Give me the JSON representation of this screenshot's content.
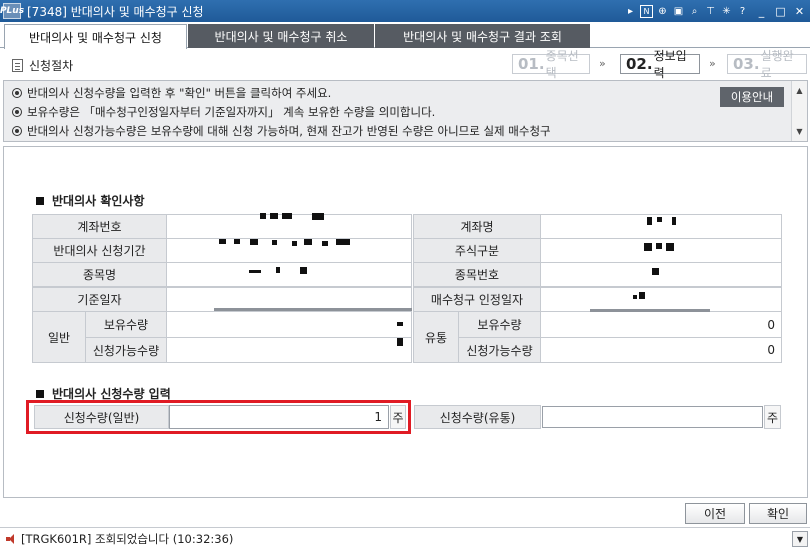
{
  "window": {
    "app_logo": "PLus",
    "title": "[7348] 반대의사 및 매수청구 신청",
    "title_icons": [
      "arrow-right-icon",
      "n-box-icon",
      "zoom-icon",
      "window-icon",
      "magnifier-icon",
      "pin-icon",
      "star-icon",
      "help-icon"
    ],
    "n_box_label": "N",
    "help_label": "?"
  },
  "tabs": [
    {
      "label": "반대의사 및 매수청구 신청",
      "active": true
    },
    {
      "label": "반대의사 및 매수청구 취소",
      "active": false
    },
    {
      "label": "반대의사 및 매수청구 결과 조회",
      "active": false
    }
  ],
  "steps": {
    "label": "신청절차",
    "items": [
      {
        "num": "01.",
        "label": "종목선택",
        "state": "done"
      },
      {
        "num": "02.",
        "label": "정보입력",
        "state": "current"
      },
      {
        "num": "03.",
        "label": "실행완료",
        "state": "pending"
      }
    ],
    "arrow": "»"
  },
  "info": {
    "lines": [
      "반대의사 신청수량을 입력한 후 \"확인\" 버튼을 클릭하여 주세요.",
      "보유수량은 「매수청구인정일자부터 기준일자까지」 계속 보유한 수량을 의미합니다.",
      "반대의사 신청가능수량은 보유수량에 대해 신청 가능하며, 현재 잔고가 반영된 수량은 아니므로 실제 매수청구"
    ],
    "guide_button": "이용안내"
  },
  "confirm_section": {
    "title": "반대의사 확인사항",
    "left_labels": [
      "계좌번호",
      "반대의사 신청기간",
      "종목명",
      "기준일자"
    ],
    "right_labels": [
      "계좌명",
      "주식구분",
      "종목번호",
      "매수청구 인정일자"
    ],
    "general": {
      "group": "일반",
      "holding_label": "보유수량",
      "available_label": "신청가능수량",
      "holding_value": "",
      "available_value": ""
    },
    "circulation": {
      "group": "유통",
      "holding_label": "보유수량",
      "available_label": "신청가능수량",
      "holding_value": "0",
      "available_value": "0"
    }
  },
  "input_section": {
    "title": "반대의사 신청수량 입력",
    "general_label": "신청수량(일반)",
    "general_value": "1",
    "general_unit": "주",
    "circulation_label": "신청수량(유통)",
    "circulation_value": "",
    "circulation_unit": "주"
  },
  "buttons": {
    "prev": "이전",
    "confirm": "확인"
  },
  "status": {
    "text": "[TRGK601R] 조회되었습니다 (10:32:36)"
  }
}
